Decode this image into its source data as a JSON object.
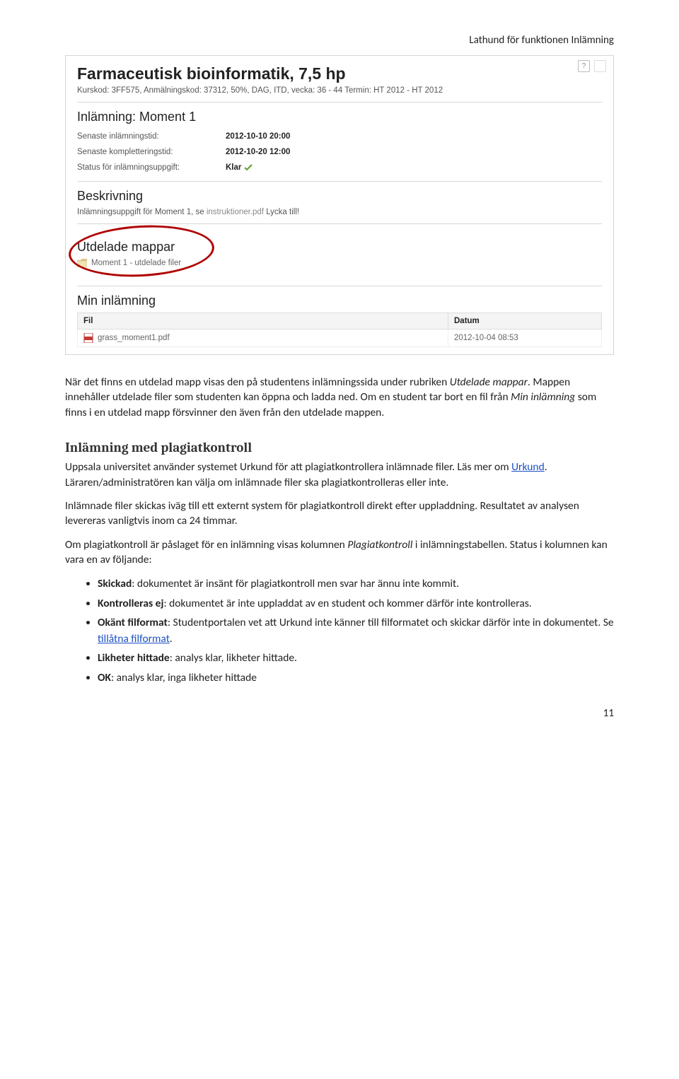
{
  "doc_header": "Lathund för funktionen Inlämning",
  "screenshot": {
    "course_title": "Farmaceutisk bioinformatik, 7,5 hp",
    "course_meta": "Kurskod: 3FF575, Anmälningskod: 37312, 50%, DAG, ITD, vecka: 36 - 44 Termin: HT 2012 - HT 2012",
    "help_glyph": "?",
    "section_inlamning": "Inlämning: Moment 1",
    "rows": {
      "deadline_label": "Senaste inlämningstid:",
      "deadline_val": "2012-10-10 20:00",
      "komplement_label": "Senaste kompletteringstid:",
      "komplement_val": "2012-10-20 12:00",
      "status_label": "Status för inlämningsuppgift:",
      "status_val": "Klar"
    },
    "section_beskrivning": "Beskrivning",
    "beskrivning_text_a": "Inlämningsuppgift för Moment 1, se ",
    "beskrivning_link": "instruktioner.pdf",
    "beskrivning_text_b": " Lycka till!",
    "section_utdelade": "Utdelade mappar",
    "folder_name": "Moment 1 - utdelade filer",
    "section_min_inlamning": "Min inlämning",
    "table": {
      "col_fil": "Fil",
      "col_datum": "Datum",
      "file_name": "grass_moment1.pdf",
      "file_date": "2012-10-04 08:53"
    }
  },
  "body": {
    "p1_a": "När det finns en utdelad mapp visas den på studentens inlämningssida under rubriken ",
    "p1_em": "Utdelade mappar",
    "p1_b": ". Mappen innehåller utdelade filer som studenten kan öppna och ladda ned. Om en student tar bort en fil från ",
    "p1_em2": "Min inlämning",
    "p1_c": " som finns i en utdelad mapp försvinner den även från den utdelade mappen.",
    "h2": "Inlämning med plagiatkontroll",
    "p2_a": "Uppsala universitet använder systemet Urkund för att plagiatkontrollera inlämnade filer. Läs mer om ",
    "p2_link": "Urkund",
    "p2_b": ". Läraren/administratören kan välja om inlämnade filer ska plagiatkontrolleras eller inte.",
    "p3": "Inlämnade filer skickas iväg till ett externt system för plagiatkontroll direkt efter uppladdning. Resultatet av analysen levereras vanligtvis inom ca 24 timmar.",
    "p4_a": "Om plagiatkontroll är påslaget för en inlämning visas kolumnen ",
    "p4_em": "Plagiatkontroll",
    "p4_b": " i inlämningstabellen. Status i kolumnen kan vara en av följande:",
    "bullets": {
      "b1_strong": "Skickad",
      "b1_rest": ": dokumentet är insänt för plagiatkontroll men svar har ännu inte kommit.",
      "b2_strong": "Kontrolleras ej",
      "b2_rest": ": dokumentet är inte uppladdat av en student och kommer därför inte kontrolleras.",
      "b3_strong": "Okänt filformat",
      "b3_rest_a": ": Studentportalen vet att Urkund inte känner till filformatet och skickar därför inte in dokumentet. Se ",
      "b3_link": "tillåtna filformat",
      "b3_rest_b": ".",
      "b4_strong": "Likheter hittade",
      "b4_rest": ": analys klar, likheter hittade.",
      "b5_strong": "OK",
      "b5_rest": ": analys klar, inga likheter hittade"
    }
  },
  "page_number": "11"
}
